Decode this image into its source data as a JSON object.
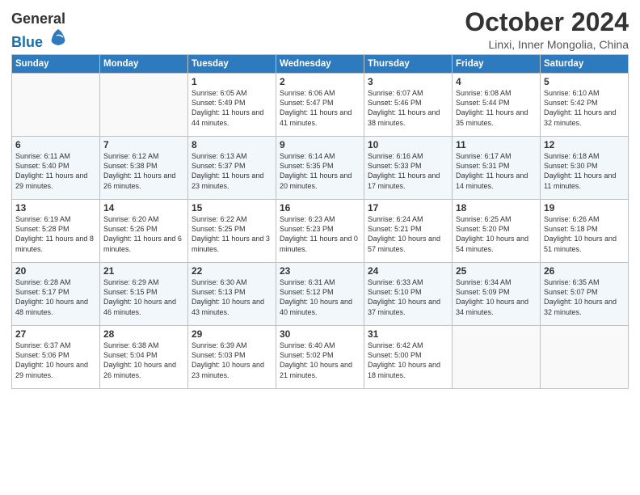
{
  "header": {
    "logo_general": "General",
    "logo_blue": "Blue",
    "month_title": "October 2024",
    "location": "Linxi, Inner Mongolia, China"
  },
  "weekdays": [
    "Sunday",
    "Monday",
    "Tuesday",
    "Wednesday",
    "Thursday",
    "Friday",
    "Saturday"
  ],
  "weeks": [
    [
      {
        "day": "",
        "info": ""
      },
      {
        "day": "",
        "info": ""
      },
      {
        "day": "1",
        "info": "Sunrise: 6:05 AM\nSunset: 5:49 PM\nDaylight: 11 hours and 44 minutes."
      },
      {
        "day": "2",
        "info": "Sunrise: 6:06 AM\nSunset: 5:47 PM\nDaylight: 11 hours and 41 minutes."
      },
      {
        "day": "3",
        "info": "Sunrise: 6:07 AM\nSunset: 5:46 PM\nDaylight: 11 hours and 38 minutes."
      },
      {
        "day": "4",
        "info": "Sunrise: 6:08 AM\nSunset: 5:44 PM\nDaylight: 11 hours and 35 minutes."
      },
      {
        "day": "5",
        "info": "Sunrise: 6:10 AM\nSunset: 5:42 PM\nDaylight: 11 hours and 32 minutes."
      }
    ],
    [
      {
        "day": "6",
        "info": "Sunrise: 6:11 AM\nSunset: 5:40 PM\nDaylight: 11 hours and 29 minutes."
      },
      {
        "day": "7",
        "info": "Sunrise: 6:12 AM\nSunset: 5:38 PM\nDaylight: 11 hours and 26 minutes."
      },
      {
        "day": "8",
        "info": "Sunrise: 6:13 AM\nSunset: 5:37 PM\nDaylight: 11 hours and 23 minutes."
      },
      {
        "day": "9",
        "info": "Sunrise: 6:14 AM\nSunset: 5:35 PM\nDaylight: 11 hours and 20 minutes."
      },
      {
        "day": "10",
        "info": "Sunrise: 6:16 AM\nSunset: 5:33 PM\nDaylight: 11 hours and 17 minutes."
      },
      {
        "day": "11",
        "info": "Sunrise: 6:17 AM\nSunset: 5:31 PM\nDaylight: 11 hours and 14 minutes."
      },
      {
        "day": "12",
        "info": "Sunrise: 6:18 AM\nSunset: 5:30 PM\nDaylight: 11 hours and 11 minutes."
      }
    ],
    [
      {
        "day": "13",
        "info": "Sunrise: 6:19 AM\nSunset: 5:28 PM\nDaylight: 11 hours and 8 minutes."
      },
      {
        "day": "14",
        "info": "Sunrise: 6:20 AM\nSunset: 5:26 PM\nDaylight: 11 hours and 6 minutes."
      },
      {
        "day": "15",
        "info": "Sunrise: 6:22 AM\nSunset: 5:25 PM\nDaylight: 11 hours and 3 minutes."
      },
      {
        "day": "16",
        "info": "Sunrise: 6:23 AM\nSunset: 5:23 PM\nDaylight: 11 hours and 0 minutes."
      },
      {
        "day": "17",
        "info": "Sunrise: 6:24 AM\nSunset: 5:21 PM\nDaylight: 10 hours and 57 minutes."
      },
      {
        "day": "18",
        "info": "Sunrise: 6:25 AM\nSunset: 5:20 PM\nDaylight: 10 hours and 54 minutes."
      },
      {
        "day": "19",
        "info": "Sunrise: 6:26 AM\nSunset: 5:18 PM\nDaylight: 10 hours and 51 minutes."
      }
    ],
    [
      {
        "day": "20",
        "info": "Sunrise: 6:28 AM\nSunset: 5:17 PM\nDaylight: 10 hours and 48 minutes."
      },
      {
        "day": "21",
        "info": "Sunrise: 6:29 AM\nSunset: 5:15 PM\nDaylight: 10 hours and 46 minutes."
      },
      {
        "day": "22",
        "info": "Sunrise: 6:30 AM\nSunset: 5:13 PM\nDaylight: 10 hours and 43 minutes."
      },
      {
        "day": "23",
        "info": "Sunrise: 6:31 AM\nSunset: 5:12 PM\nDaylight: 10 hours and 40 minutes."
      },
      {
        "day": "24",
        "info": "Sunrise: 6:33 AM\nSunset: 5:10 PM\nDaylight: 10 hours and 37 minutes."
      },
      {
        "day": "25",
        "info": "Sunrise: 6:34 AM\nSunset: 5:09 PM\nDaylight: 10 hours and 34 minutes."
      },
      {
        "day": "26",
        "info": "Sunrise: 6:35 AM\nSunset: 5:07 PM\nDaylight: 10 hours and 32 minutes."
      }
    ],
    [
      {
        "day": "27",
        "info": "Sunrise: 6:37 AM\nSunset: 5:06 PM\nDaylight: 10 hours and 29 minutes."
      },
      {
        "day": "28",
        "info": "Sunrise: 6:38 AM\nSunset: 5:04 PM\nDaylight: 10 hours and 26 minutes."
      },
      {
        "day": "29",
        "info": "Sunrise: 6:39 AM\nSunset: 5:03 PM\nDaylight: 10 hours and 23 minutes."
      },
      {
        "day": "30",
        "info": "Sunrise: 6:40 AM\nSunset: 5:02 PM\nDaylight: 10 hours and 21 minutes."
      },
      {
        "day": "31",
        "info": "Sunrise: 6:42 AM\nSunset: 5:00 PM\nDaylight: 10 hours and 18 minutes."
      },
      {
        "day": "",
        "info": ""
      },
      {
        "day": "",
        "info": ""
      }
    ]
  ]
}
